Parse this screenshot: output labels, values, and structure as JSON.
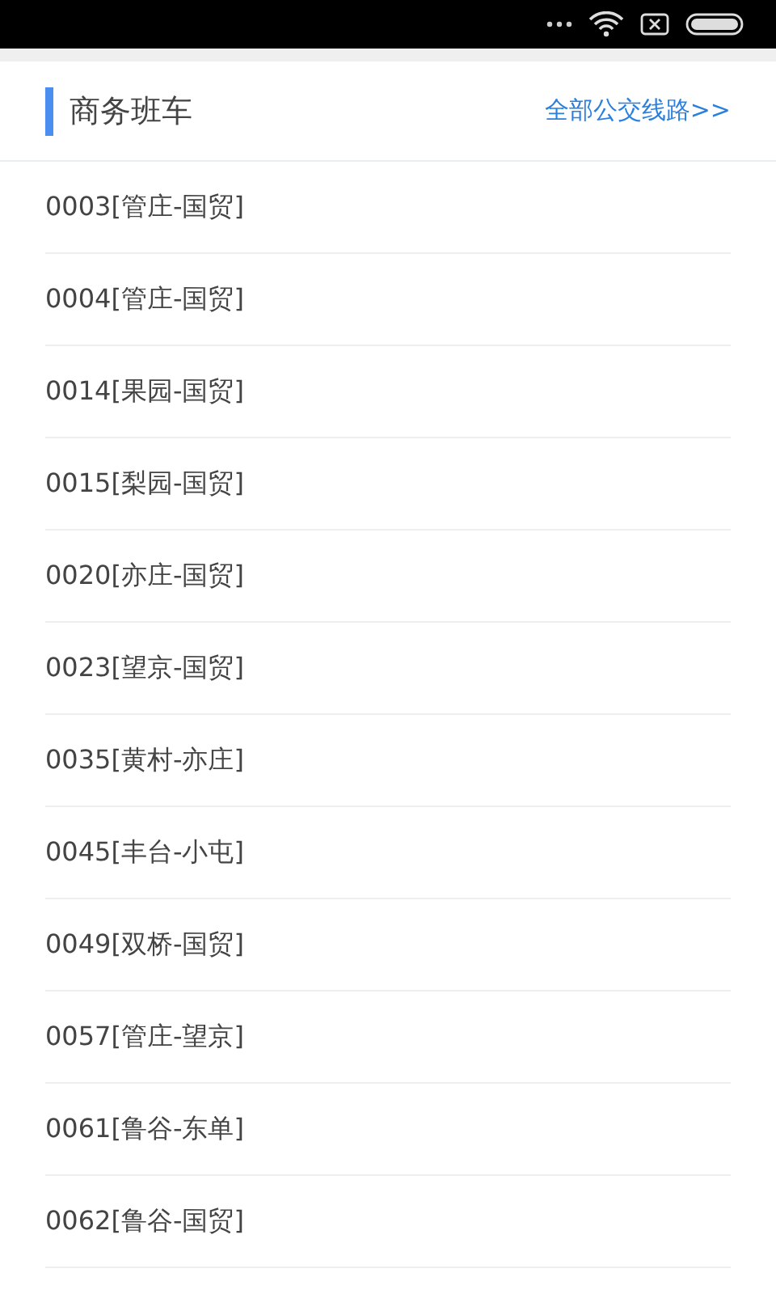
{
  "header": {
    "title": "商务班车",
    "link": "全部公交线路>>"
  },
  "routes": [
    {
      "label": "0003[管庄-国贸]"
    },
    {
      "label": "0004[管庄-国贸]"
    },
    {
      "label": "0014[果园-国贸]"
    },
    {
      "label": "0015[梨园-国贸]"
    },
    {
      "label": "0020[亦庄-国贸]"
    },
    {
      "label": "0023[望京-国贸]"
    },
    {
      "label": "0035[黄村-亦庄]"
    },
    {
      "label": "0045[丰台-小屯]"
    },
    {
      "label": "0049[双桥-国贸]"
    },
    {
      "label": "0057[管庄-望京]"
    },
    {
      "label": "0061[鲁谷-东单]"
    },
    {
      "label": "0062[鲁谷-国贸]"
    }
  ]
}
